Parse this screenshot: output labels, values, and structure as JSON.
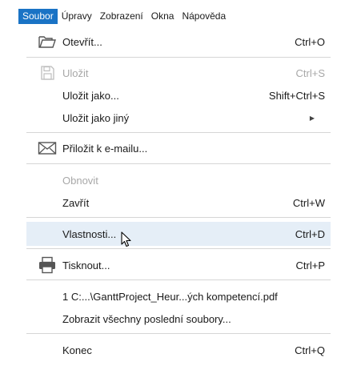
{
  "menubar": {
    "items": [
      "Soubor",
      "Úpravy",
      "Zobrazení",
      "Okna",
      "Nápověda"
    ]
  },
  "menu": {
    "items": [
      {
        "label": "Otevřít...",
        "shortcut": "Ctrl+O",
        "icon": "folder-open-icon"
      },
      {
        "label": "Uložit",
        "shortcut": "Ctrl+S",
        "icon": "save-icon"
      },
      {
        "label": "Uložit jako...",
        "shortcut": "Shift+Ctrl+S"
      },
      {
        "label": "Uložit jako jiný",
        "shortcut": ""
      },
      {
        "label": "Přiložit k e-mailu...",
        "shortcut": "",
        "icon": "envelope-icon"
      },
      {
        "label": "Obnovit",
        "shortcut": ""
      },
      {
        "label": "Zavřít",
        "shortcut": "Ctrl+W"
      },
      {
        "label": "Vlastnosti...",
        "shortcut": "Ctrl+D"
      },
      {
        "label": "Tisknout...",
        "shortcut": "Ctrl+P",
        "icon": "printer-icon"
      },
      {
        "label": "1 C:...\\GanttProject_Heur...ých kompetencí.pdf",
        "shortcut": ""
      },
      {
        "label": "Zobrazit všechny poslední soubory...",
        "shortcut": ""
      },
      {
        "label": "Konec",
        "shortcut": "Ctrl+Q"
      }
    ]
  },
  "colors": {
    "menubar_active_bg": "#1a73c5",
    "hover_bg": "#e5eef7",
    "disabled_text": "#a8a8a8"
  }
}
